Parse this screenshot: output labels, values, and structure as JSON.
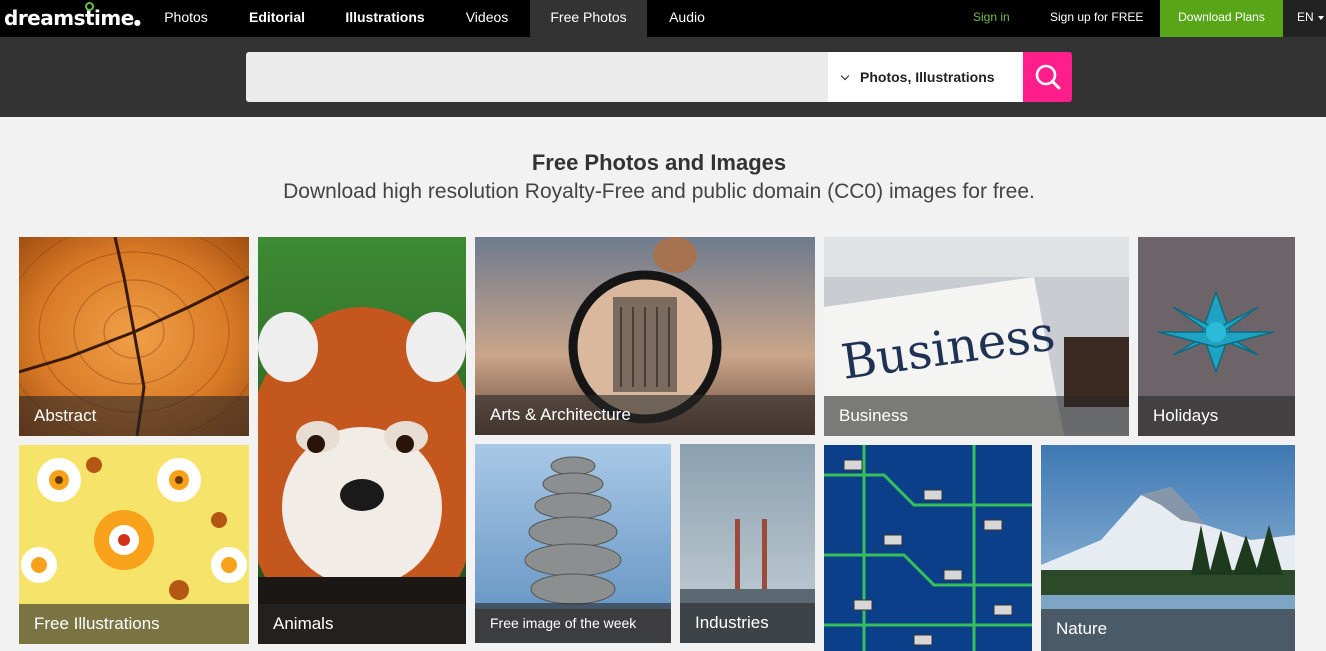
{
  "nav": {
    "logo": "dreamstime",
    "links": [
      "Photos",
      "Editorial",
      "Illustrations",
      "Videos",
      "Free Photos",
      "Audio"
    ],
    "sign_in": "Sign in",
    "sign_up": "Sign up for FREE",
    "download_plans": "Download Plans",
    "language": "EN"
  },
  "search": {
    "placeholder": "",
    "category": "Photos, Illustrations"
  },
  "heading": {
    "title": "Free Photos and Images",
    "subtitle": "Download high resolution Royalty-Free and public domain (CC0) images for free."
  },
  "categories": [
    "Abstract",
    "Animals",
    "Arts & Architecture",
    "Business",
    "Holidays",
    "Free Illustrations",
    "Free image of the week",
    "Industries",
    "Nature"
  ],
  "colors": {
    "accent_search": "#ff1e8c",
    "accent_green": "#58a618",
    "sign_in_green": "#6cc04a"
  }
}
